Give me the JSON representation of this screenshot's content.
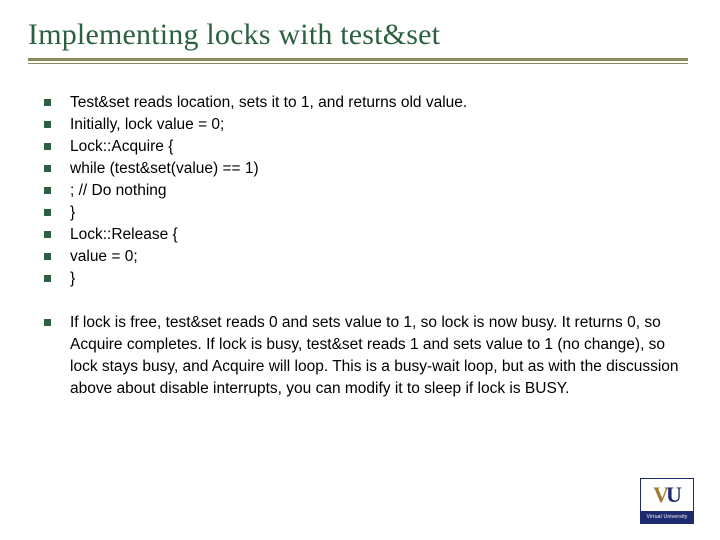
{
  "title": "Implementing locks with test&set",
  "bullets_block1": [
    "Test&set reads location, sets it to 1, and returns old value.",
    "Initially, lock value = 0;",
    "Lock::Acquire {",
    "while (test&set(value) == 1)",
    "; // Do nothing",
    "}",
    "Lock::Release {",
    "value = 0;",
    "}"
  ],
  "bullets_block2": [
    "If lock is free, test&set reads 0 and sets value to 1, so lock is now busy. It returns 0, so Acquire completes. If lock is busy, test&set reads 1 and sets value to 1 (no change), so lock stays busy, and Acquire will loop. This is a busy-wait loop, but as with the discussion above about disable interrupts, you can modify it to sleep if lock is BUSY."
  ],
  "logo": {
    "letters_v": "V",
    "letters_u": "U",
    "subtitle": "Virtual University"
  }
}
